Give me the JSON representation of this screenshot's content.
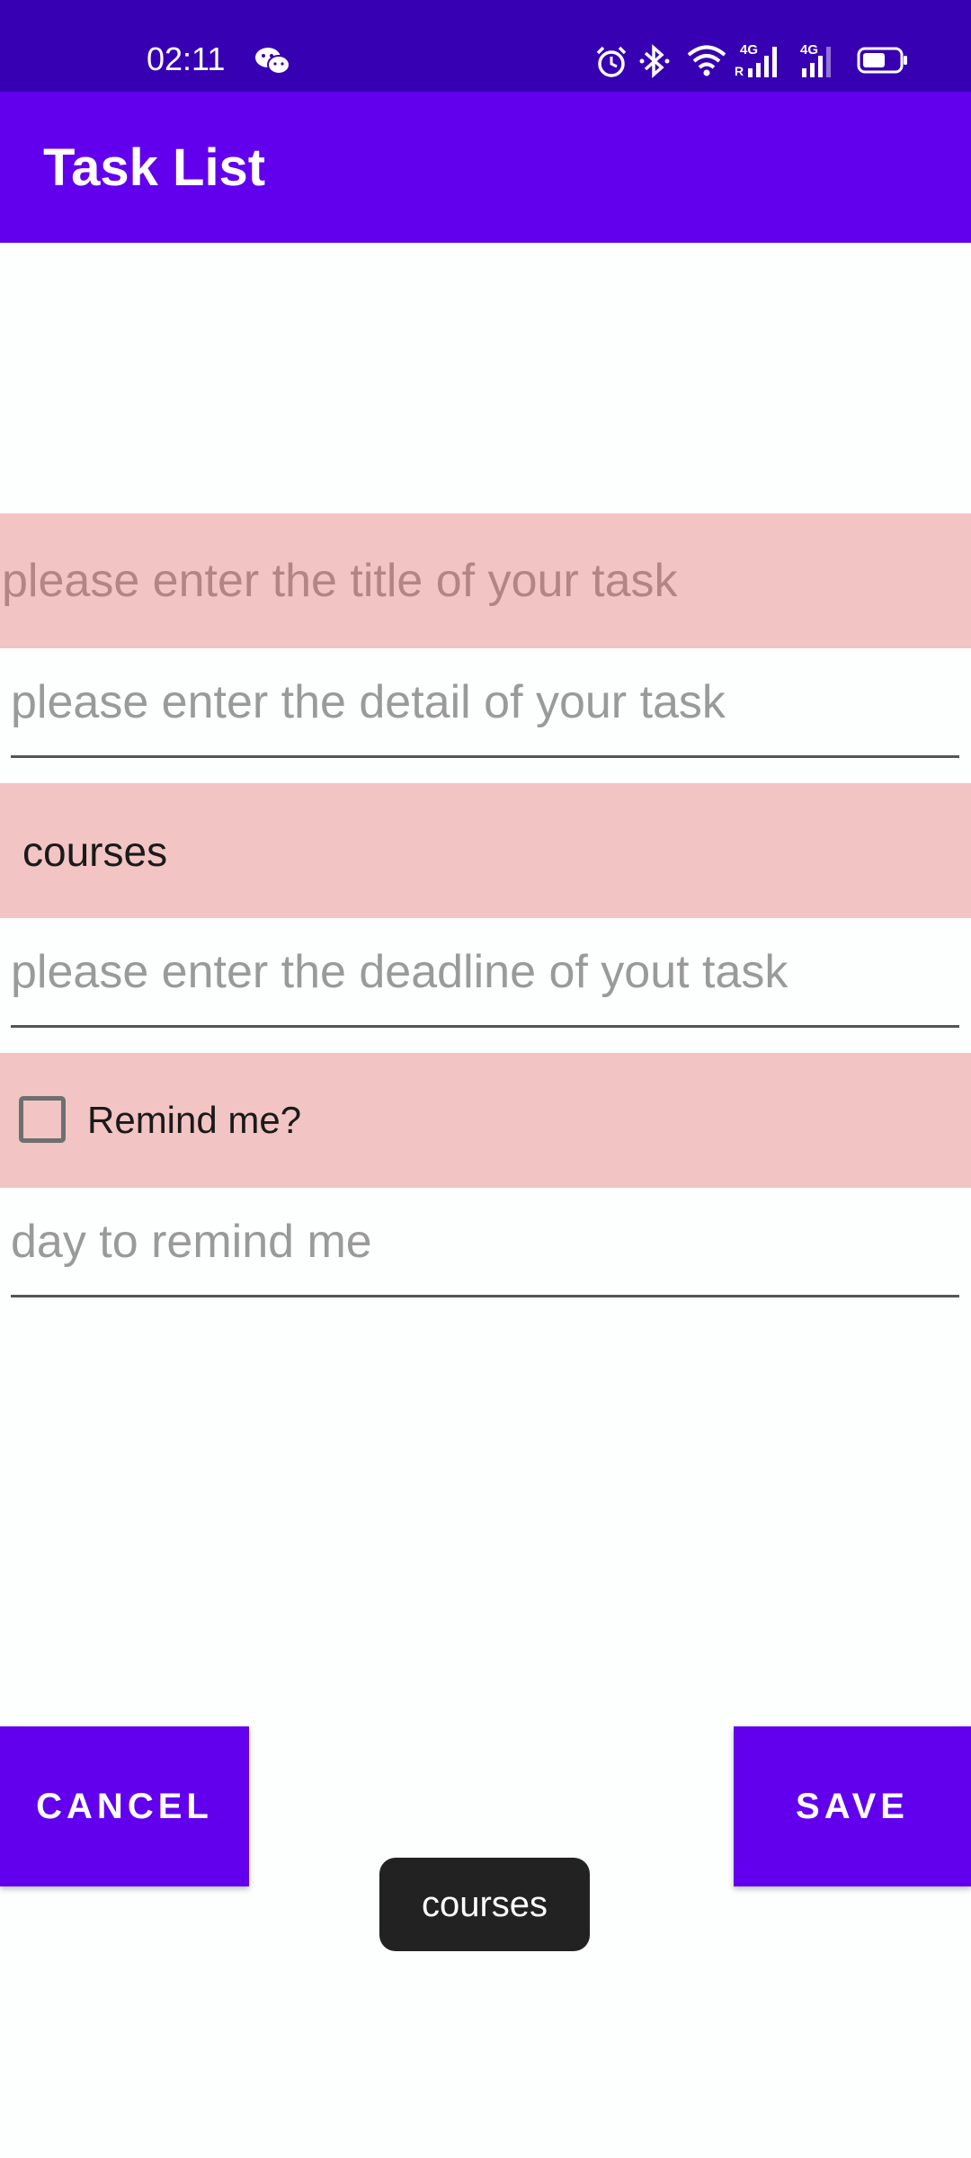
{
  "status_bar": {
    "time": "02:11",
    "icons": [
      "wechat-icon",
      "alarm-icon",
      "bluetooth-icon",
      "wifi-icon",
      "signal-4g-r-icon",
      "signal-4g-icon",
      "battery-icon"
    ],
    "network_labels": [
      "4G",
      "R",
      "4G"
    ],
    "background": "#3700b3"
  },
  "app_bar": {
    "title": "Task List",
    "background": "#6200ee"
  },
  "form": {
    "title_input": {
      "value": "",
      "placeholder": "please enter the title of your task"
    },
    "detail_input": {
      "value": "",
      "placeholder": "please enter the detail of your task"
    },
    "category_spinner": {
      "selected": "courses"
    },
    "deadline_input": {
      "value": "",
      "placeholder": "please enter the deadline of yout task"
    },
    "remind_checkbox": {
      "label": "Remind me?",
      "checked": false
    },
    "remind_day_input": {
      "value": "",
      "placeholder": "day to remind me"
    },
    "row_highlight_color": "#f2c4c4"
  },
  "actions": {
    "cancel_label": "CANCEL",
    "save_label": "SAVE",
    "button_color": "#6200ee"
  },
  "toast": {
    "message": "courses"
  }
}
